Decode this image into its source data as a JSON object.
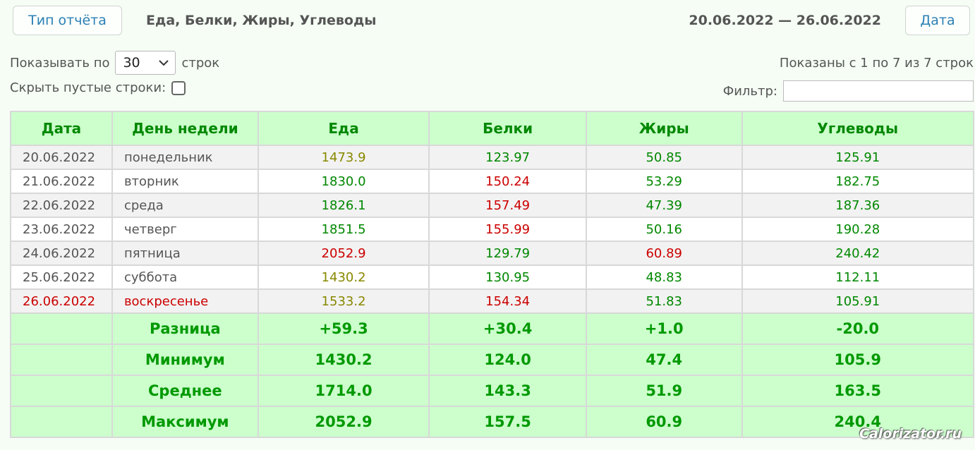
{
  "header": {
    "type_button": "Тип отчёта",
    "report_title": "Еда, Белки, Жиры, Углеводы",
    "date_range": "20.06.2022 — 26.06.2022",
    "date_button": "Дата"
  },
  "controls": {
    "show_label": "Показывать по",
    "rows_value": "30",
    "rows_suffix": "строк",
    "shown_info": "Показаны с 1 по 7 из 7 строк",
    "hide_empty_label": "Скрыть пустые строки:",
    "filter_label": "Фильтр:"
  },
  "table": {
    "headers": [
      "Дата",
      "День недели",
      "Еда",
      "Белки",
      "Жиры",
      "Углеводы"
    ],
    "rows": [
      {
        "date": "20.06.2022",
        "day": "понедельник",
        "food": "1473.9",
        "protein": "123.97",
        "fat": "50.85",
        "carbs": "125.91"
      },
      {
        "date": "21.06.2022",
        "day": "вторник",
        "food": "1830.0",
        "protein": "150.24",
        "fat": "53.29",
        "carbs": "182.75"
      },
      {
        "date": "22.06.2022",
        "day": "среда",
        "food": "1826.1",
        "protein": "157.49",
        "fat": "47.39",
        "carbs": "187.36"
      },
      {
        "date": "23.06.2022",
        "day": "четверг",
        "food": "1851.5",
        "protein": "155.99",
        "fat": "50.16",
        "carbs": "190.28"
      },
      {
        "date": "24.06.2022",
        "day": "пятница",
        "food": "2052.9",
        "protein": "129.79",
        "fat": "60.89",
        "carbs": "240.42"
      },
      {
        "date": "25.06.2022",
        "day": "суббота",
        "food": "1430.2",
        "protein": "130.95",
        "fat": "48.83",
        "carbs": "112.11"
      },
      {
        "date": "26.06.2022",
        "day": "воскресенье",
        "food": "1533.2",
        "protein": "154.34",
        "fat": "51.83",
        "carbs": "105.91"
      }
    ],
    "summary": [
      {
        "label": "Разница",
        "food": "+59.3",
        "protein": "+30.4",
        "fat": "+1.0",
        "carbs": "-20.0"
      },
      {
        "label": "Минимум",
        "food": "1430.2",
        "protein": "124.0",
        "fat": "47.4",
        "carbs": "105.9"
      },
      {
        "label": "Среднее",
        "food": "1714.0",
        "protein": "143.3",
        "fat": "51.9",
        "carbs": "163.5"
      },
      {
        "label": "Максимум",
        "food": "2052.9",
        "protein": "157.5",
        "fat": "60.9",
        "carbs": "240.4"
      }
    ]
  },
  "colors": {
    "header_bg": "#ccffcc",
    "green": "#008800",
    "red": "#cc0000",
    "olive": "#888800",
    "link": "#2a7fb5"
  },
  "watermark": "Calorizator.ru"
}
